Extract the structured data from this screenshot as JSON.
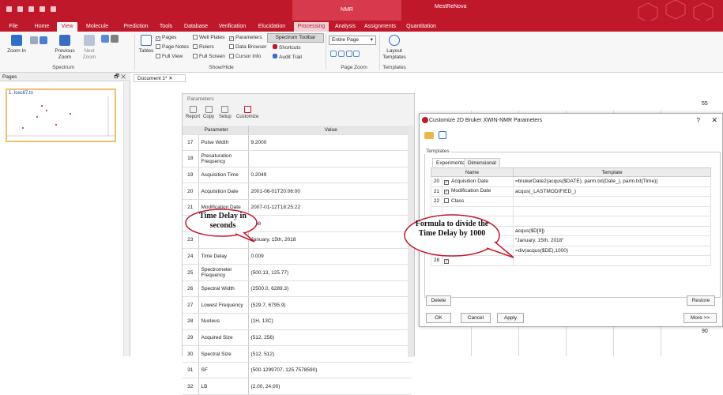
{
  "app": {
    "title": "MestReNova",
    "context_tab": "NMR"
  },
  "menu": {
    "tabs": [
      "File",
      "Home",
      "View",
      "Molecule",
      "Prediction",
      "Tools",
      "Database",
      "Verification",
      "Elucidation",
      "Processing",
      "Analysis",
      "Assignments",
      "Quantitation"
    ],
    "active": "View"
  },
  "ribbon": {
    "spectrum_group": {
      "label": "Spectrum",
      "zoom_in": "Zoom In",
      "previous_zoom": "Previous Zoom",
      "next_zoom": "Next Zoom"
    },
    "tables_label": "Tables",
    "show_hide": {
      "label": "Show/Hide",
      "items": [
        {
          "label": "Pages",
          "checked": true
        },
        {
          "label": "Page Notes",
          "checked": false
        },
        {
          "label": "Full View",
          "checked": false
        },
        {
          "label": "Well Plates",
          "checked": false
        },
        {
          "label": "Rulers",
          "checked": false
        },
        {
          "label": "Full Screen",
          "checked": false
        },
        {
          "label": "Parameters",
          "checked": true
        },
        {
          "label": "Data Browser",
          "checked": false
        },
        {
          "label": "Cursor Info",
          "checked": false
        }
      ],
      "spectrum_toolbar": "Spectrum Toolbar",
      "shortcuts": "Shortcuts",
      "audit_trail": "Audit Trail"
    },
    "page_zoom": {
      "label": "Page Zoom",
      "select": "Entire Page"
    },
    "templates": {
      "label": "Templates",
      "layout": "Layout Templates"
    }
  },
  "pages_panel": {
    "title": "Pages",
    "thumb_title": "1. Icec67.tn"
  },
  "document_tab": "Document 1*",
  "parameters": {
    "title": "Parameters",
    "toolbar": [
      "Report",
      "Copy",
      "Setup",
      "Customize"
    ],
    "headers": [
      "Parameter",
      "Value"
    ],
    "rows": [
      {
        "n": "17",
        "p": "Pulse Width",
        "v": "9.2000"
      },
      {
        "n": "18",
        "p": "Presaturation Frequency",
        "v": ""
      },
      {
        "n": "19",
        "p": "Acquisition Time",
        "v": "0.2049"
      },
      {
        "n": "20",
        "p": "Acquisition Date",
        "v": "2001-06-01T20:06:00"
      },
      {
        "n": "21",
        "p": "Modification Date",
        "v": "2007-01-12T18:25:22"
      },
      {
        "n": "22",
        "p": "",
        "v": "0.08"
      },
      {
        "n": "23",
        "p": "",
        "v": "January, 15th, 2018"
      },
      {
        "n": "24",
        "p": "Time Delay",
        "v": "0.009"
      },
      {
        "n": "25",
        "p": "Spectrometer Frequency",
        "v": "(500.13, 125.77)"
      },
      {
        "n": "26",
        "p": "Spectral Width",
        "v": "(2500.0, 6289.3)"
      },
      {
        "n": "27",
        "p": "Lowest Frequency",
        "v": "(529.7, 6795.9)"
      },
      {
        "n": "28",
        "p": "Nucleus",
        "v": "(1H, 13C)"
      },
      {
        "n": "29",
        "p": "Acquired Size",
        "v": "(512, 256)"
      },
      {
        "n": "30",
        "p": "Spectral Size",
        "v": "(512, 512)"
      },
      {
        "n": "31",
        "p": "SF",
        "v": "(500.1299707, 125.7578590)"
      },
      {
        "n": "32",
        "p": "LB",
        "v": "(2.00, 24.00)"
      }
    ]
  },
  "spectrum": {
    "axis_top": "55",
    "axis_bottom": "90"
  },
  "dialog": {
    "title": "Customize 2D Bruker XWIN-NMR Parameters",
    "group": "Templates",
    "tabs": [
      "Experimental",
      "Dimensional"
    ],
    "headers": [
      "Name",
      "Template"
    ],
    "rows": [
      {
        "n": "20",
        "checked": true,
        "name": "Acquisition Date",
        "tpl": "=brukerDate2(acqus($DATE), parm.txt(Date_), parm.txt(Time))"
      },
      {
        "n": "21",
        "checked": true,
        "name": "Modification Date",
        "tpl": "acqus(_LASTMODIFIED_)"
      },
      {
        "n": "22",
        "checked": false,
        "name": "Class",
        "tpl": ""
      },
      {
        "n": "",
        "checked": false,
        "name": "",
        "tpl": ""
      },
      {
        "n": "",
        "checked": false,
        "name": "",
        "tpl": ""
      },
      {
        "n": "",
        "checked": false,
        "name": "",
        "tpl": "acqus($D[9])"
      },
      {
        "n": "26",
        "checked": false,
        "name": "",
        "tpl": "\"January, 15th, 2018\""
      },
      {
        "n": "27",
        "checked": true,
        "name": "Time Delay",
        "tpl": "=div(acqus($DE),1000)"
      },
      {
        "n": "28",
        "checked": true,
        "name": "",
        "tpl": ""
      }
    ],
    "buttons": {
      "delete": "Delete",
      "restore": "Restore",
      "ok": "OK",
      "cancel": "Cancel",
      "apply": "Apply",
      "more": "More >>"
    }
  },
  "callouts": {
    "left": "Time Delay in seconds",
    "right": "Formula to divide the Time Delay by 1000"
  },
  "colors": {
    "brand": "#c0182b",
    "processing_tab": "#f0cfd4"
  }
}
